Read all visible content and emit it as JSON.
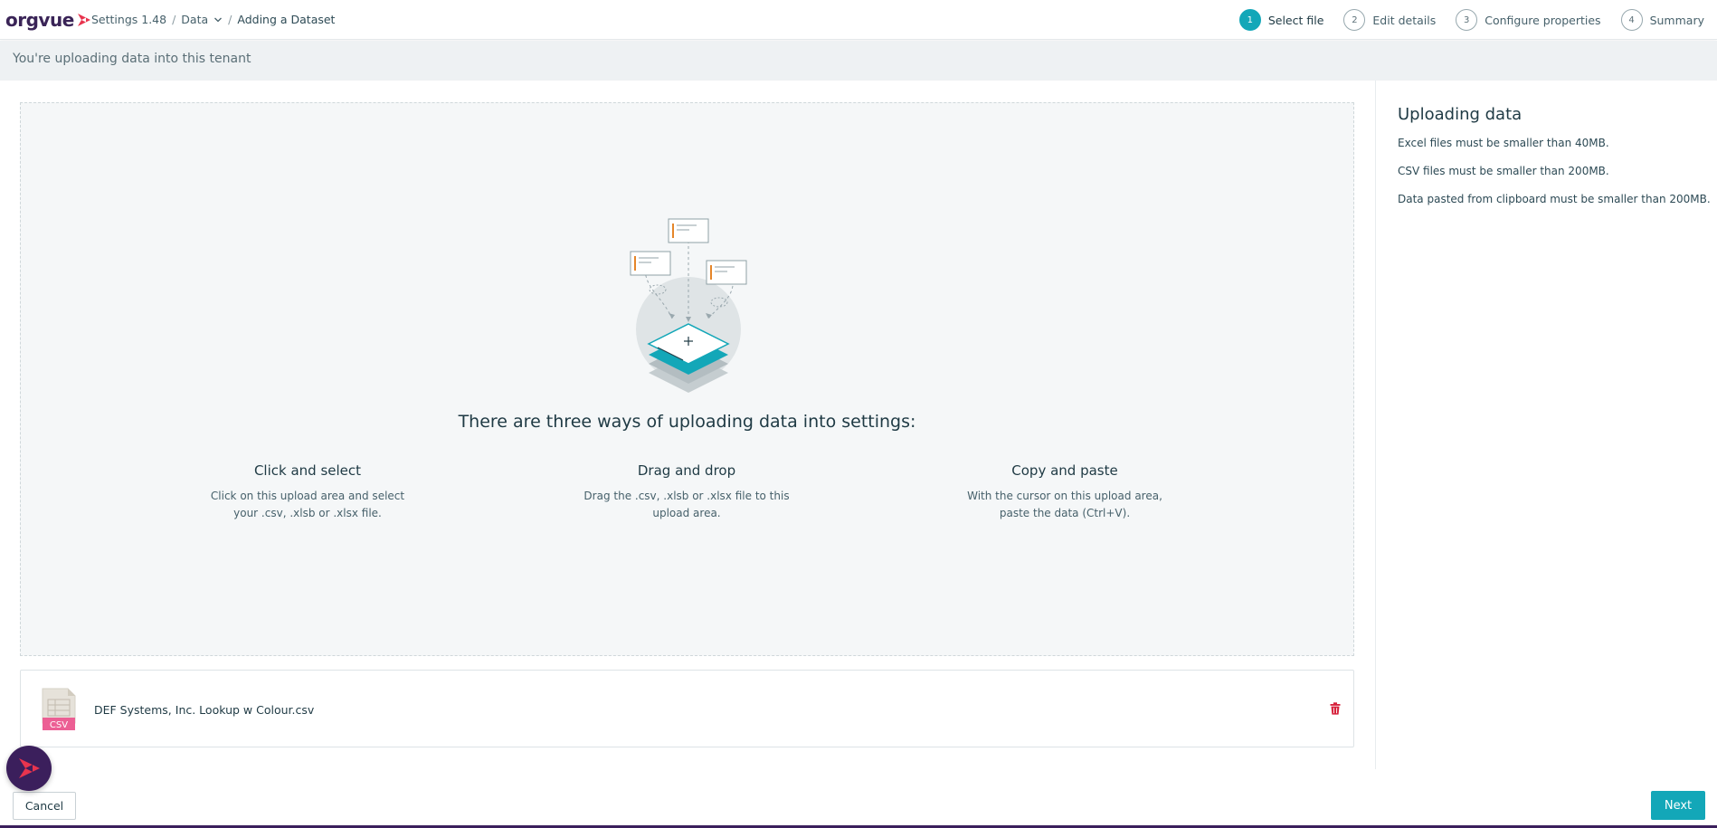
{
  "header": {
    "brand": "orgvue",
    "breadcrumb": {
      "settings": "Settings 1.48",
      "data": "Data",
      "current": "Adding a Dataset"
    },
    "steps": [
      {
        "num": "1",
        "label": "Select file",
        "active": true
      },
      {
        "num": "2",
        "label": "Edit details",
        "active": false
      },
      {
        "num": "3",
        "label": "Configure properties",
        "active": false
      },
      {
        "num": "4",
        "label": "Summary",
        "active": false
      }
    ]
  },
  "info_bar": "You're uploading data into this tenant",
  "dropzone": {
    "title": "There are three ways of uploading data into settings:",
    "ways": [
      {
        "title": "Click and select",
        "line1": "Click on this upload area and select",
        "line2": "your .csv, .xlsb or .xlsx file."
      },
      {
        "title": "Drag and drop",
        "line1": "Drag the .csv, .xlsb or .xlsx file to this",
        "line2": "upload area."
      },
      {
        "title": "Copy and paste",
        "line1": "With the cursor on this upload area,",
        "line2": "paste the data (Ctrl+V)."
      }
    ]
  },
  "file": {
    "type_badge": "CSV",
    "name": "DEF Systems, Inc. Lookup w Colour.csv",
    "delete_icon": "trash-icon"
  },
  "aside": {
    "title": "Uploading data",
    "rules": [
      "Excel files must be smaller than 40MB.",
      "CSV files must be smaller than 200MB.",
      "Data pasted from clipboard must be smaller than 200MB."
    ]
  },
  "footer": {
    "cancel_label": "Cancel",
    "next_label": "Next"
  },
  "colors": {
    "accent": "#13a7b8",
    "brand_purple": "#3b1f5c",
    "brand_red": "#e8344e",
    "delete_red": "#d6203a"
  }
}
